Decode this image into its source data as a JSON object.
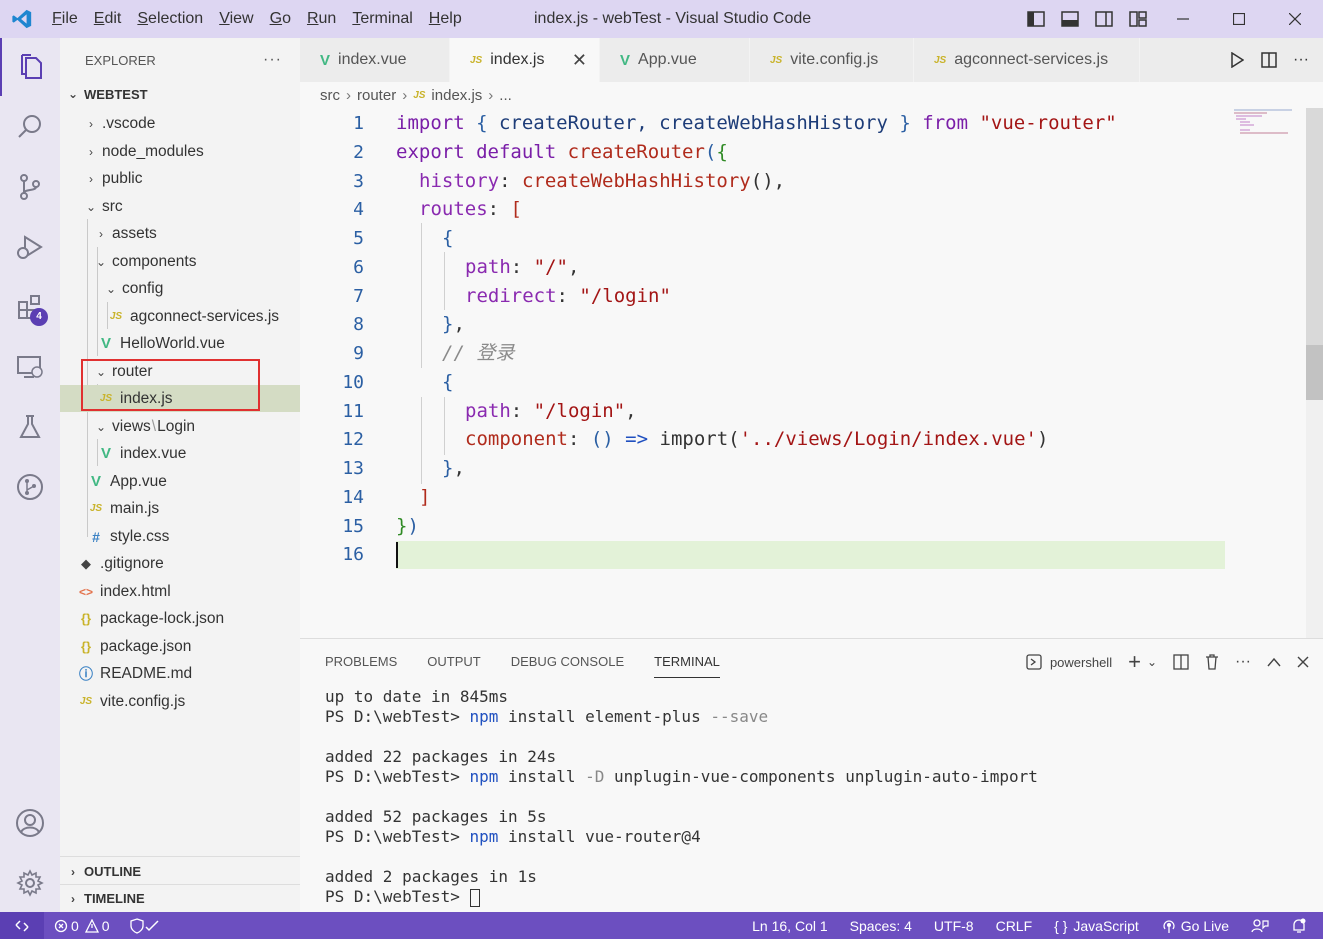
{
  "titlebar": {
    "menu": [
      "File",
      "Edit",
      "Selection",
      "View",
      "Go",
      "Run",
      "Terminal",
      "Help"
    ],
    "title": "index.js - webTest - Visual Studio Code"
  },
  "activitybar": {
    "extensions_badge": "4"
  },
  "sidebar": {
    "header": "EXPLORER",
    "more": "···",
    "root": "WEBTEST",
    "tree": [
      {
        "label": ".vscode"
      },
      {
        "label": "node_modules"
      },
      {
        "label": "public"
      },
      {
        "label": "src"
      },
      {
        "label": "assets"
      },
      {
        "label": "components"
      },
      {
        "label": "config"
      },
      {
        "label": "agconnect-services.js"
      },
      {
        "label": "HelloWorld.vue"
      },
      {
        "label": "router"
      },
      {
        "label": "index.js"
      },
      {
        "label": "views"
      },
      {
        "label": "Login"
      },
      {
        "label": "index.vue"
      },
      {
        "label": "App.vue"
      },
      {
        "label": "main.js"
      },
      {
        "label": "style.css"
      },
      {
        "label": ".gitignore"
      },
      {
        "label": "index.html"
      },
      {
        "label": "package-lock.json"
      },
      {
        "label": "package.json"
      },
      {
        "label": "README.md"
      },
      {
        "label": "vite.config.js"
      }
    ],
    "outline": "OUTLINE",
    "timeline": "TIMELINE"
  },
  "tabs": [
    {
      "label": "index.vue",
      "icon": "V"
    },
    {
      "label": "index.js",
      "icon": "JS"
    },
    {
      "label": "App.vue",
      "icon": "V"
    },
    {
      "label": "vite.config.js",
      "icon": "JS"
    },
    {
      "label": "agconnect-services.js",
      "icon": "JS"
    }
  ],
  "breadcrumb": {
    "parts": [
      "src",
      "router",
      "index.js",
      "..."
    ],
    "js_icon": "JS"
  },
  "editor": {
    "line_numbers": [
      "1",
      "2",
      "3",
      "4",
      "5",
      "6",
      "7",
      "8",
      "9",
      "10",
      "11",
      "12",
      "13",
      "14",
      "15",
      "16"
    ],
    "code": {
      "l1": [
        "import",
        " ",
        "{",
        " createRouter, createWebHashHistory ",
        "}",
        " from ",
        "\"vue-router\""
      ],
      "l2": [
        "export",
        " ",
        "default",
        " ",
        "createRouter",
        "(",
        "{"
      ],
      "l3": [
        "history",
        ": ",
        "createWebHashHistory",
        "(),"
      ],
      "l4": [
        "routes",
        ": ",
        "["
      ],
      "l5": [
        "{"
      ],
      "l6": [
        "path",
        ": ",
        "\"/\"",
        ","
      ],
      "l7": [
        "redirect",
        ": ",
        "\"/login\""
      ],
      "l8": [
        "}",
        ","
      ],
      "l9": [
        "// 登录"
      ],
      "l10": [
        "{"
      ],
      "l11": [
        "path",
        ": ",
        "\"/login\"",
        ","
      ],
      "l12": [
        "component",
        ": ",
        "()",
        " => ",
        "import(",
        "'../views/Login/index.vue'",
        ")"
      ],
      "l13": [
        "}",
        ","
      ],
      "l14": [
        "]"
      ],
      "l15": [
        "}",
        ")"
      ]
    }
  },
  "panel": {
    "tabs": [
      "PROBLEMS",
      "OUTPUT",
      "DEBUG CONSOLE",
      "TERMINAL"
    ],
    "shell": "powershell",
    "terminal": {
      "l1": "up to date in 845ms",
      "p1": "PS D:\\webTest> ",
      "c1a": "npm",
      "c1b": " install element-plus ",
      "c1c": "--save",
      "l3": "added 22 packages in 24s",
      "p2": "PS D:\\webTest> ",
      "c2a": "npm",
      "c2b": " install ",
      "c2c": "-D",
      "c2d": " unplugin-vue-components unplugin-auto-import",
      "l5": "added 52 packages in 5s",
      "p3": "PS D:\\webTest> ",
      "c3a": "npm",
      "c3b": " install vue-router@4",
      "l7": "added 2 packages in 1s",
      "p4": "PS D:\\webTest> "
    }
  },
  "statusbar": {
    "errors": "0",
    "warnings": "0",
    "position": "Ln 16, Col 1",
    "spaces": "Spaces: 4",
    "encoding": "UTF-8",
    "eol": "CRLF",
    "language": "JavaScript",
    "golive": "Go Live"
  }
}
